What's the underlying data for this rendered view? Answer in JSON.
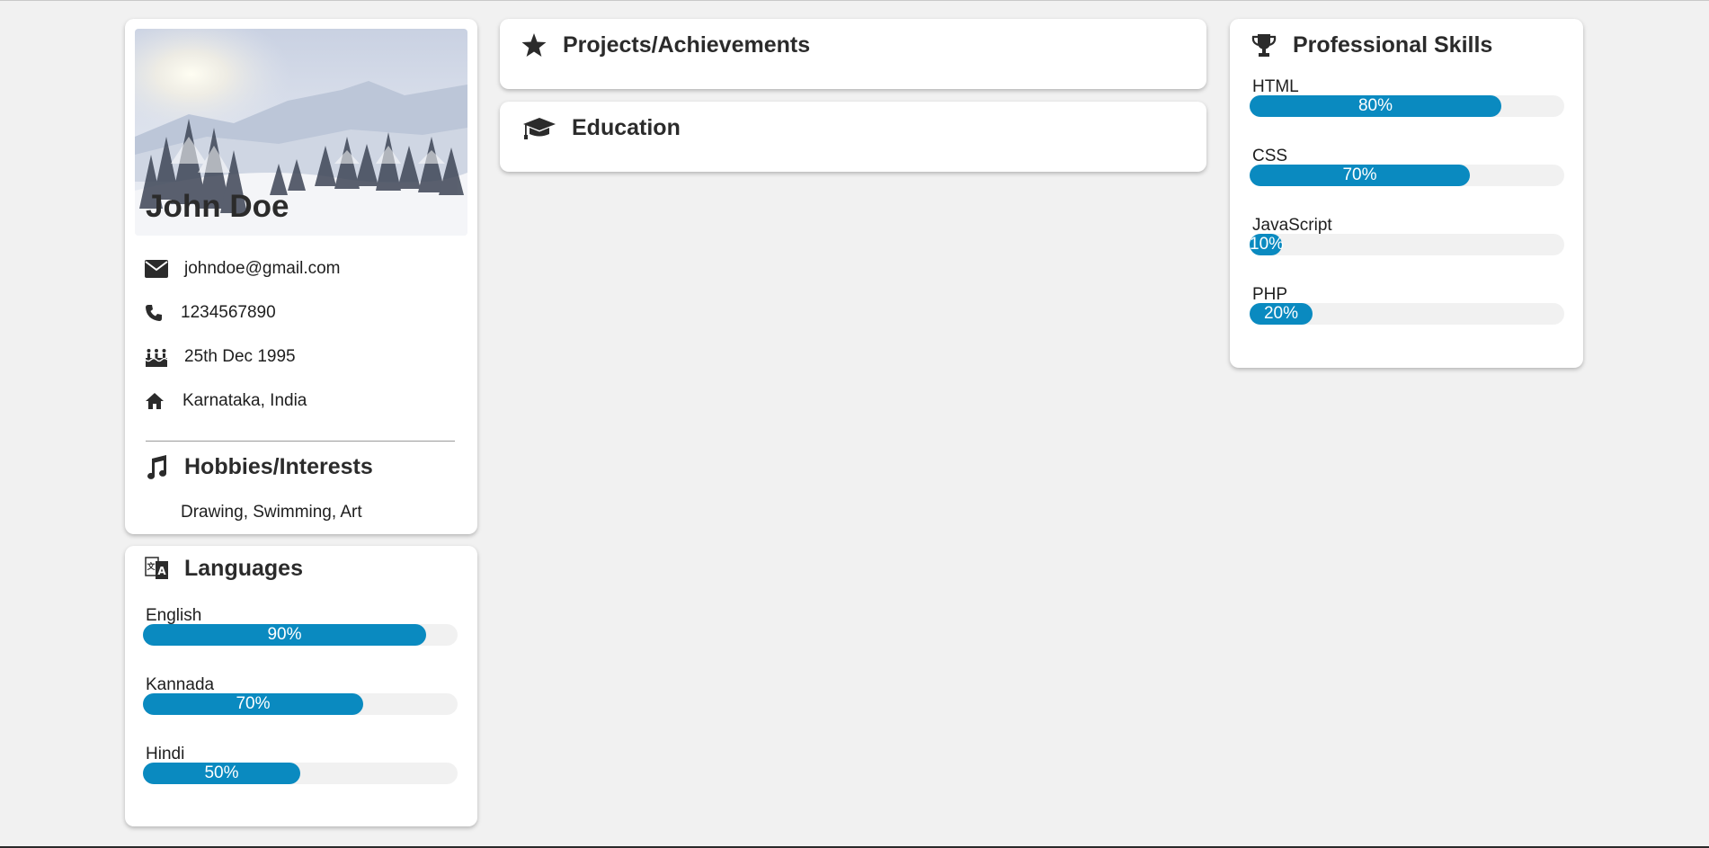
{
  "profile": {
    "name": "John Doe",
    "email": "johndoe@gmail.com",
    "phone": "1234567890",
    "birthday": "25th Dec 1995",
    "location": "Karnataka, India"
  },
  "hobbies": {
    "title": "Hobbies/Interests",
    "text": "Drawing, Swimming, Art"
  },
  "languages": {
    "title": "Languages",
    "items": [
      {
        "label": "English",
        "percent": 90,
        "text": "90%"
      },
      {
        "label": "Kannada",
        "percent": 70,
        "text": "70%"
      },
      {
        "label": "Hindi",
        "percent": 50,
        "text": "50%"
      }
    ]
  },
  "projects": {
    "title": "Projects/Achievements"
  },
  "education": {
    "title": "Education"
  },
  "skills": {
    "title": "Professional Skills",
    "items": [
      {
        "label": "HTML",
        "percent": 80,
        "text": "80%"
      },
      {
        "label": "CSS",
        "percent": 70,
        "text": "70%"
      },
      {
        "label": "JavaScript",
        "percent": 10,
        "text": "10%"
      },
      {
        "label": "PHP",
        "percent": 20,
        "text": "20%"
      }
    ]
  },
  "colors": {
    "bar": "#0a8ac0",
    "track": "#f1f1f1",
    "background": "#f1f1f1",
    "icon": "#2b2b2b"
  },
  "icons": {
    "email": "envelope-icon",
    "phone": "phone-icon",
    "birthday": "birthday-cake-icon",
    "location": "home-icon",
    "hobbies": "music-note-icon",
    "languages": "language-icon",
    "projects": "star-icon",
    "education": "graduation-cap-icon",
    "skills": "trophy-icon"
  }
}
